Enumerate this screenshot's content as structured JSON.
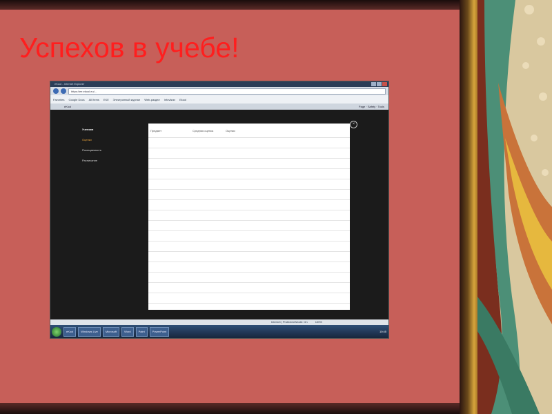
{
  "slide": {
    "title": "Успехов в учебе!"
  },
  "browser": {
    "window_title": "eKool - Internet Explorer",
    "url": "https://ee.ekool.eu/...",
    "tab_label": "eKool",
    "favorites": [
      "Favorites",
      "Google Docs",
      "All Items",
      "ЕКЛ",
      "Электронный журнал",
      "Web-раздел",
      "Infovärav",
      "Ekool"
    ],
    "menu_right": [
      "Page",
      "Safety",
      "Tools"
    ],
    "status_text": "Internet | Protected Mode: On",
    "zoom": "100%"
  },
  "sidebar": {
    "header": "Ученики",
    "items": [
      "Оценки",
      "Посещаемость",
      "Расписание"
    ]
  },
  "table": {
    "col_subject": "Предмет",
    "col_average": "Средняя оценка",
    "col_marks": "Оценки",
    "rows": [
      {
        "subject": "",
        "average": "",
        "marks": ""
      },
      {
        "subject": "",
        "average": "",
        "marks": ""
      },
      {
        "subject": "",
        "average": "",
        "marks": ""
      },
      {
        "subject": "",
        "average": "",
        "marks": ""
      },
      {
        "subject": "",
        "average": "",
        "marks": ""
      },
      {
        "subject": "",
        "average": "",
        "marks": ""
      },
      {
        "subject": "",
        "average": "",
        "marks": ""
      },
      {
        "subject": "",
        "average": "",
        "marks": ""
      },
      {
        "subject": "",
        "average": "",
        "marks": ""
      },
      {
        "subject": "",
        "average": "",
        "marks": ""
      },
      {
        "subject": "",
        "average": "",
        "marks": ""
      },
      {
        "subject": "",
        "average": "",
        "marks": ""
      },
      {
        "subject": "",
        "average": "",
        "marks": ""
      },
      {
        "subject": "",
        "average": "",
        "marks": ""
      },
      {
        "subject": "",
        "average": "",
        "marks": ""
      },
      {
        "subject": "",
        "average": "",
        "marks": ""
      }
    ]
  },
  "taskbar": {
    "items": [
      "eKool",
      "Windows Live",
      "Microsoft",
      "Word",
      "Paint",
      "PowerPoint"
    ],
    "clock": "10:45"
  }
}
